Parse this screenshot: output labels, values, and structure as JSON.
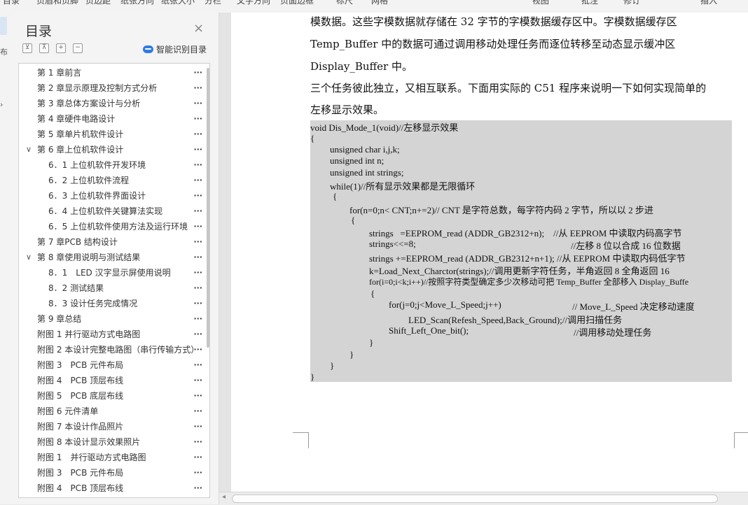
{
  "ribbon": {
    "items": [
      "目录",
      "页眉和页脚",
      "页边距",
      "纸张方向",
      "纸张大小",
      "分栏",
      "文字方向",
      "页面边框",
      "标尺",
      "网格",
      "视图",
      "批注",
      "修订",
      "插入"
    ]
  },
  "left_rail": {
    "glyph1": "⊟",
    "glyph2": "布",
    "glyph3": "›"
  },
  "toc_panel": {
    "title": "目录",
    "close": "×",
    "tools": [
      "⊻",
      "⊼",
      "+",
      "−"
    ],
    "smart_label": "智能识别目录",
    "items": [
      {
        "text": "第 1 章前言",
        "level": 1,
        "chevron": ""
      },
      {
        "text": "第 2 章显示原理及控制方式分析",
        "level": 1,
        "chevron": ""
      },
      {
        "text": "第 3 章总体方案设计与分析",
        "level": 1,
        "chevron": ""
      },
      {
        "text": "第 4 章硬件电路设计",
        "level": 1,
        "chevron": ""
      },
      {
        "text": "第 5 章单片机软件设计",
        "level": 1,
        "chevron": ""
      },
      {
        "text": "第 6 章上位机软件设计",
        "level": 1,
        "chevron": "∨"
      },
      {
        "text": "6．1 上位机软件开发环境",
        "level": 2,
        "chevron": ""
      },
      {
        "text": "6．2 上位机软件流程",
        "level": 2,
        "chevron": ""
      },
      {
        "text": "6．3 上位机软件界面设计",
        "level": 2,
        "chevron": ""
      },
      {
        "text": "6．4 上位机软件关键算法实现",
        "level": 2,
        "chevron": ""
      },
      {
        "text": "6．5 上位机软件使用方法及运行环境",
        "level": 2,
        "chevron": ""
      },
      {
        "text": "第 7 章PCB 结构设计",
        "level": 1,
        "chevron": ""
      },
      {
        "text": "第 8 章使用说明与测试结果",
        "level": 1,
        "chevron": "∨"
      },
      {
        "text": "8．1　LED 汉字显示屏使用说明",
        "level": 2,
        "chevron": ""
      },
      {
        "text": "8．2 测试结果",
        "level": 2,
        "chevron": ""
      },
      {
        "text": "8．3 设计任务完成情况",
        "level": 2,
        "chevron": ""
      },
      {
        "text": "第 9 章总结",
        "level": 1,
        "chevron": ""
      },
      {
        "text": "附图 1 并行驱动方式电路图",
        "level": 1,
        "chevron": ""
      },
      {
        "text": "附图 2 本设计完整电路图（串行传输方式）",
        "level": 1,
        "chevron": ""
      },
      {
        "text": "附图 3　PCB 元件布局",
        "level": 1,
        "chevron": ""
      },
      {
        "text": "附图 4　PCB 顶层布线",
        "level": 1,
        "chevron": ""
      },
      {
        "text": "附图 5　PCB 底层布线",
        "level": 1,
        "chevron": ""
      },
      {
        "text": "附图 6 元件清单",
        "level": 1,
        "chevron": ""
      },
      {
        "text": "附图 7 本设计作品照片",
        "level": 1,
        "chevron": ""
      },
      {
        "text": "附图 8 本设计显示效果照片",
        "level": 1,
        "chevron": ""
      },
      {
        "text": "附图 1　并行驱动方式电路图",
        "level": 1,
        "chevron": ""
      },
      {
        "text": "附图 3　PCB 元件布局",
        "level": 1,
        "chevron": ""
      },
      {
        "text": "附图 4　PCB 顶层布线",
        "level": 1,
        "chevron": ""
      }
    ]
  },
  "document": {
    "paragraphs": [
      "模数据。这些字模数据就存储在 32 字节的字模数据缓存区中。字模数据缓存区",
      "Temp_Buffer 中的数据可通过调用移动处理任务而逐位转移至动态显示缓冲区",
      "Display_Buffer 中。",
      "三个任务彼此独立，又相互联系。下面用实际的 C51 程序来说明一下如何实现简单的",
      "左移显示效果。"
    ],
    "code_lines": [
      "void Dis_Mode_1(void)//左移显示效果",
      "{",
      "unsigned char i,j,k;",
      "unsigned int n;",
      "unsigned int strings;",
      "while(1)//所有显示效果都是无限循环",
      "{",
      "for(n=0;n< CNT;n+=2)// CNT 是字符总数，每字符内码 2 字节，所以以 2 步进",
      "{",
      "strings   =EEPROM_read (ADDR_GB2312+n);    //从 EEPROM 中读取内码高字节",
      "strings<<=8;",
      "//左移 8 位以合成 16 位数据",
      "strings +=EEPROM_read (ADDR_GB2312+n+1); //从 EEPROM 中读取内码低字节",
      "k=Load_Next_Charctor(strings);//调用更新字符任务，半角返回 8 全角返回 16",
      "for(i=0;i<k;i++)//按照字符类型确定多少次移动可把 Temp_Buffer 全部移入 Display_Buffe",
      "{",
      "for(j=0;j<Move_L_Speed;j++)",
      "// Move_L_Speed 决定移动速度",
      "LED_Scan(Refesh_Speed,Back_Ground);//调用扫描任务",
      "Shift_Left_One_bit();",
      "//调用移动处理任务",
      "}",
      "}",
      "}",
      "}"
    ]
  }
}
